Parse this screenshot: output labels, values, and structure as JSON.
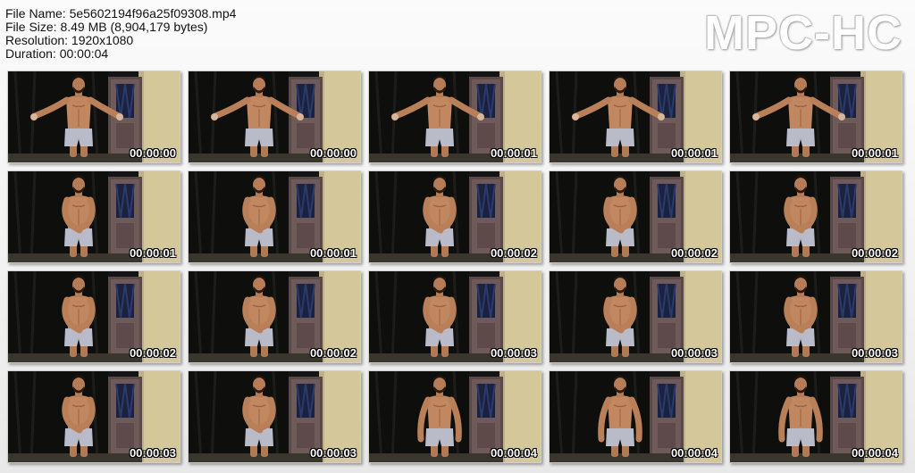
{
  "header": {
    "file_name": "File Name: 5e5602194f96a25f09308.mp4",
    "file_size": "File Size: 8.49 MB (8,904,179 bytes)",
    "resolution": "Resolution: 1920x1080",
    "duration": "Duration: 00:00:04"
  },
  "logo": "MPC-HC",
  "thumbnails": [
    {
      "time": "00:00:00",
      "pose": "arms-out"
    },
    {
      "time": "00:00:00",
      "pose": "arms-out"
    },
    {
      "time": "00:00:01",
      "pose": "arms-out"
    },
    {
      "time": "00:00:01",
      "pose": "arms-out"
    },
    {
      "time": "00:00:01",
      "pose": "arms-out"
    },
    {
      "time": "00:00:01",
      "pose": "hands-front"
    },
    {
      "time": "00:00:01",
      "pose": "hands-front"
    },
    {
      "time": "00:00:02",
      "pose": "hands-front"
    },
    {
      "time": "00:00:02",
      "pose": "hands-front"
    },
    {
      "time": "00:00:02",
      "pose": "hands-front"
    },
    {
      "time": "00:00:02",
      "pose": "hands-front"
    },
    {
      "time": "00:00:02",
      "pose": "hands-front"
    },
    {
      "time": "00:00:03",
      "pose": "hands-front"
    },
    {
      "time": "00:00:03",
      "pose": "hands-front"
    },
    {
      "time": "00:00:03",
      "pose": "hands-front"
    },
    {
      "time": "00:00:03",
      "pose": "hands-front"
    },
    {
      "time": "00:00:03",
      "pose": "hands-front"
    },
    {
      "time": "00:00:04",
      "pose": "arms-down"
    },
    {
      "time": "00:00:04",
      "pose": "arms-down"
    },
    {
      "time": "00:00:04",
      "pose": "arms-down"
    }
  ]
}
